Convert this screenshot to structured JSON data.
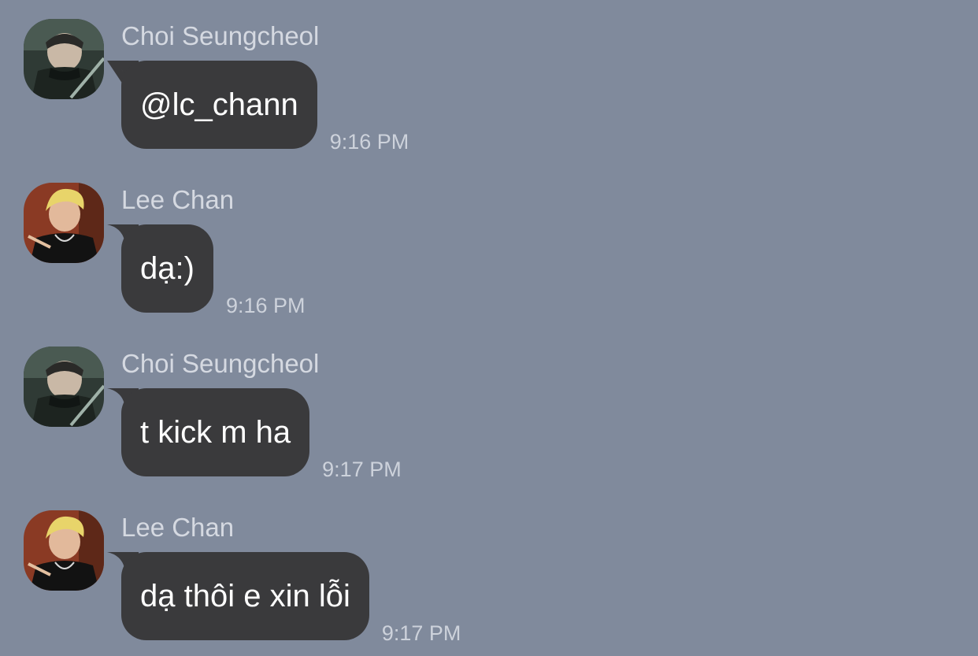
{
  "messages": [
    {
      "sender": "Choi Seungcheol",
      "avatar_icon": "user-avatar-icon",
      "text": "@lc_chann",
      "time": "9:16 PM"
    },
    {
      "sender": "Lee Chan",
      "avatar_icon": "user-avatar-icon",
      "text": "dạ:)",
      "time": "9:16 PM"
    },
    {
      "sender": "Choi Seungcheol",
      "avatar_icon": "user-avatar-icon",
      "text": "t kick m ha",
      "time": "9:17 PM"
    },
    {
      "sender": "Lee Chan",
      "avatar_icon": "user-avatar-icon",
      "text": "dạ thôi e xin lỗi",
      "time": "9:17 PM"
    }
  ],
  "colors": {
    "background": "#808a9c",
    "bubble": "#3a3a3c",
    "bubble_text": "#ffffff",
    "sender_text": "#d5d9e1",
    "time_text": "#cdd2db"
  }
}
